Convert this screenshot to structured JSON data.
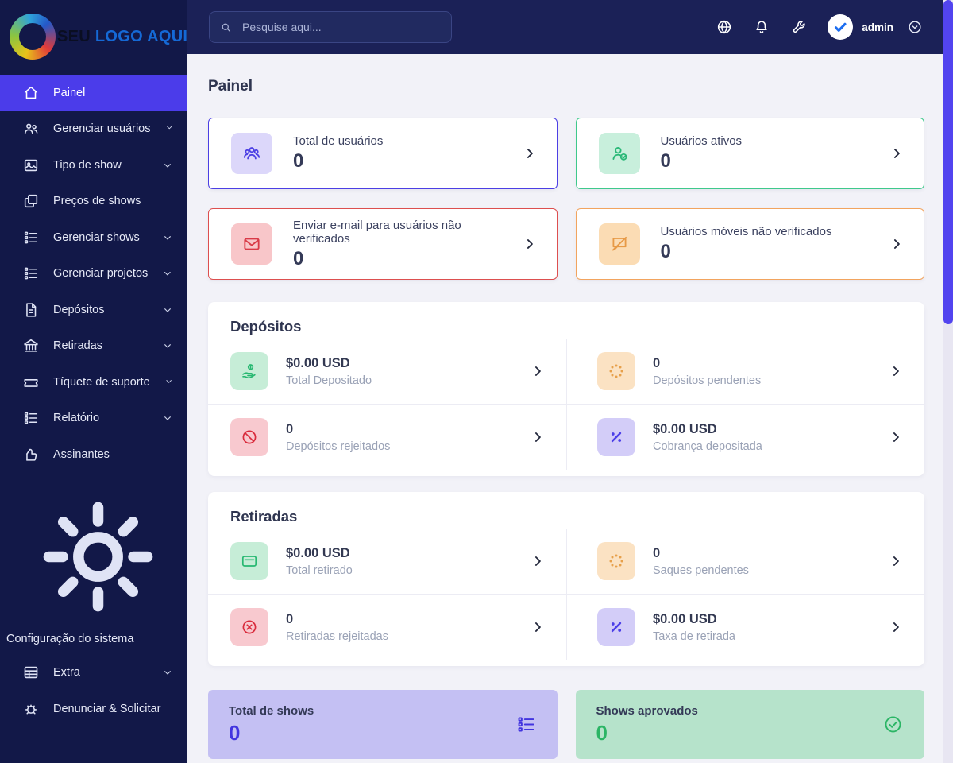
{
  "brand": {
    "name_dark": "SEU",
    "name_accent": "LOGO AQUI"
  },
  "topbar": {
    "search_placeholder": "Pesquise aqui...",
    "username": "admin"
  },
  "sidebar": {
    "items": [
      {
        "label": "Painel",
        "icon": "home-icon",
        "active": true
      },
      {
        "label": "Gerenciar usuários",
        "icon": "users-icon",
        "expandable": true
      },
      {
        "label": "Tipo de show",
        "icon": "image-icon",
        "expandable": true
      },
      {
        "label": "Preços de shows",
        "icon": "copy-icon"
      },
      {
        "label": "Gerenciar shows",
        "icon": "list-icon",
        "expandable": true
      },
      {
        "label": "Gerenciar projetos",
        "icon": "list-icon",
        "expandable": true
      },
      {
        "label": "Depósitos",
        "icon": "file-invoice-icon",
        "expandable": true
      },
      {
        "label": "Retiradas",
        "icon": "bank-icon",
        "expandable": true
      },
      {
        "label": "Tíquete de suporte",
        "icon": "ticket-icon",
        "expandable": true
      },
      {
        "label": "Relatório",
        "icon": "report-icon",
        "expandable": true
      },
      {
        "label": "Assinantes",
        "icon": "thumbs-up-icon"
      },
      {
        "label": "Configuração do sistema",
        "icon": "gear-icon"
      },
      {
        "label": "Extra",
        "icon": "table-icon",
        "expandable": true
      },
      {
        "label": "Denunciar & Solicitar",
        "icon": "bug-icon"
      }
    ]
  },
  "page": {
    "title": "Painel"
  },
  "stat_cards": [
    {
      "label": "Total de usuários",
      "value": "0",
      "accent": "#4c3fe4",
      "icon": "users-group-icon"
    },
    {
      "label": "Usuários ativos",
      "value": "0",
      "accent": "#3fc98c",
      "icon": "user-check-icon"
    },
    {
      "label": "Enviar e-mail para usuários não verificados",
      "value": "0",
      "accent": "#dd4f4f",
      "icon": "envelope-icon"
    },
    {
      "label": "Usuários móveis não verificados",
      "value": "0",
      "accent": "#f2a45f",
      "icon": "chat-slash-icon"
    }
  ],
  "deposits": {
    "title": "Depósitos",
    "rows": [
      {
        "value": "$0.00 USD",
        "label": "Total Depositado",
        "icon": "hand-dollar-icon",
        "tone": "green"
      },
      {
        "value": "0",
        "label": "Depósitos pendentes",
        "icon": "spinner-icon",
        "tone": "orange"
      },
      {
        "value": "0",
        "label": "Depósitos rejeitados",
        "icon": "ban-icon",
        "tone": "red"
      },
      {
        "value": "$0.00 USD",
        "label": "Cobrança depositada",
        "icon": "percent-icon",
        "tone": "purple"
      }
    ]
  },
  "withdrawals": {
    "title": "Retiradas",
    "rows": [
      {
        "value": "$0.00 USD",
        "label": "Total retirado",
        "icon": "credit-card-icon",
        "tone": "green"
      },
      {
        "value": "0",
        "label": "Saques pendentes",
        "icon": "spinner-icon",
        "tone": "orange"
      },
      {
        "value": "0",
        "label": "Retiradas rejeitadas",
        "icon": "x-circle-icon",
        "tone": "red"
      },
      {
        "value": "$0.00 USD",
        "label": "Taxa de retirada",
        "icon": "percent-icon",
        "tone": "purple"
      }
    ]
  },
  "bottom_cards": [
    {
      "label": "Total de shows",
      "value": "0",
      "accent": "#4234df",
      "icon": "list-icon"
    },
    {
      "label": "Shows aprovados",
      "value": "0",
      "accent": "#2bb565",
      "icon": "check-circle-icon"
    }
  ],
  "colors": {
    "sidebar_bg": "#121848",
    "header_bg": "#1b2157",
    "active_item": "#4b3cea",
    "page_bg": "#f2f2f8",
    "scrollbar_thumb": "#5244ef"
  }
}
